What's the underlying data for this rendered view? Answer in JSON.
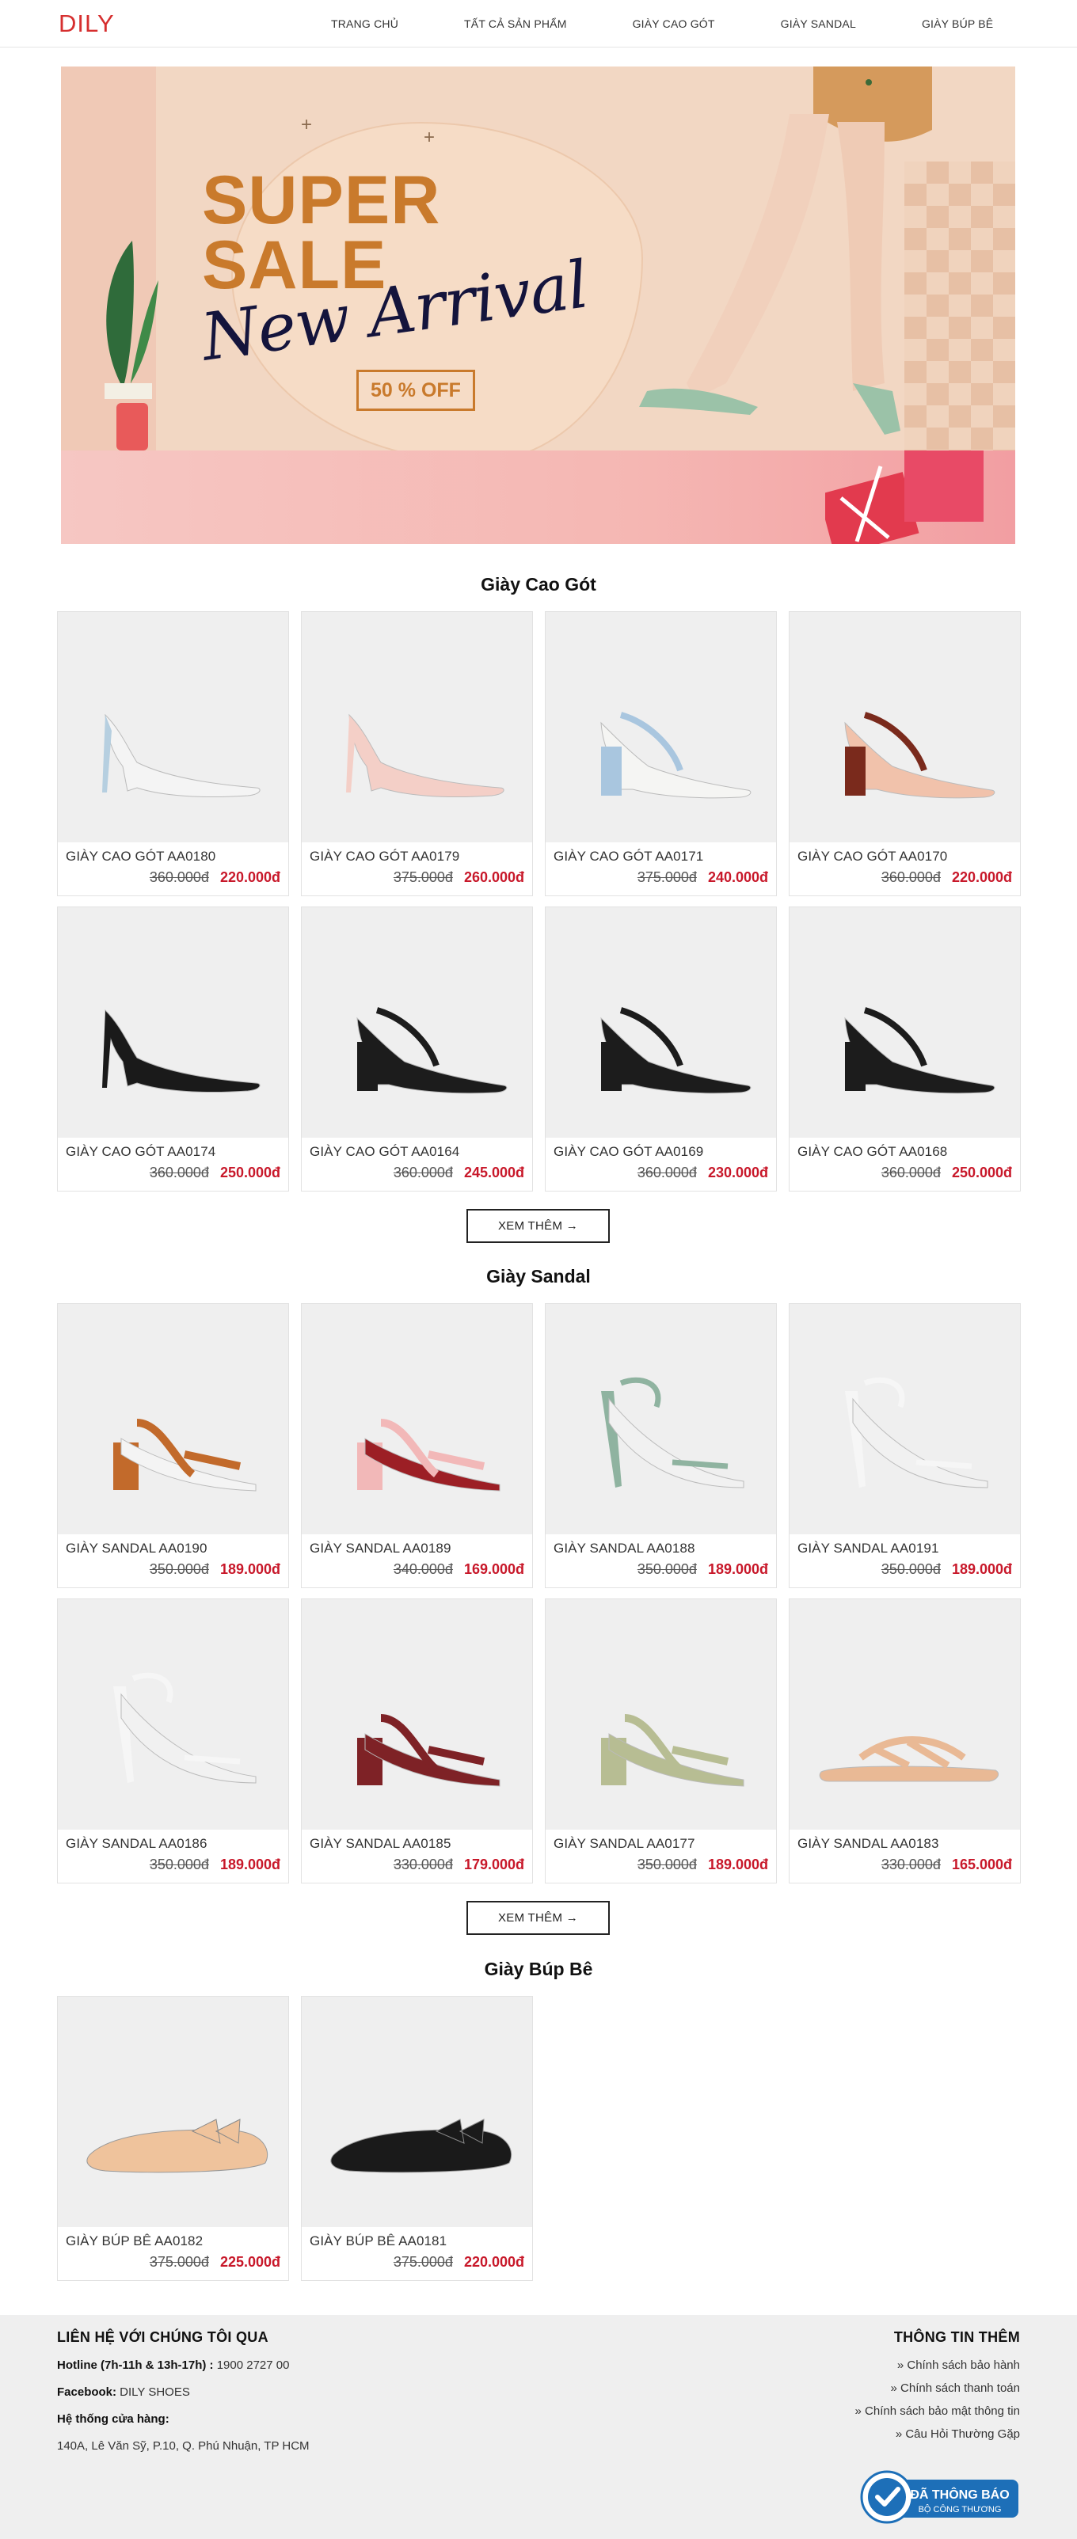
{
  "header": {
    "logo": "DILY",
    "nav": [
      "TRANG CHỦ",
      "TẤT CẢ SẢN PHẨM",
      "GIÀY CAO GÓT",
      "GIÀY SANDAL",
      "GIÀY BÚP BÊ"
    ]
  },
  "banner": {
    "line1": "SUPER",
    "line2": "SALE",
    "script": "New Arrival",
    "discount": "50 % OFF"
  },
  "sections": [
    {
      "title": "Giày Cao Gót",
      "more": "XEM THÊM →",
      "products": [
        {
          "name": "GIÀY CAO GÓT AA0180",
          "old": "360.000đ",
          "new": "220.000đ",
          "color": "#f4f4f4",
          "accent": "#b6cfe0",
          "style": "heel"
        },
        {
          "name": "GIÀY CAO GÓT AA0179",
          "old": "375.000đ",
          "new": "260.000đ",
          "color": "#f4cfc7",
          "accent": "#f4cfc7",
          "style": "pump"
        },
        {
          "name": "GIÀY CAO GÓT AA0171",
          "old": "375.000đ",
          "new": "240.000đ",
          "color": "#f5f5f3",
          "accent": "#a9c6df",
          "style": "block"
        },
        {
          "name": "GIÀY CAO GÓT AA0170",
          "old": "360.000đ",
          "new": "220.000đ",
          "color": "#f1c2ab",
          "accent": "#7a2a1c",
          "style": "block"
        },
        {
          "name": "GIÀY CAO GÓT AA0174",
          "old": "360.000đ",
          "new": "250.000đ",
          "color": "#1a1a1a",
          "accent": "#1a1a1a",
          "style": "pump"
        },
        {
          "name": "GIÀY CAO GÓT AA0164",
          "old": "360.000đ",
          "new": "245.000đ",
          "color": "#1c1c1c",
          "accent": "#1c1c1c",
          "style": "block"
        },
        {
          "name": "GIÀY CAO GÓT AA0169",
          "old": "360.000đ",
          "new": "230.000đ",
          "color": "#1c1c1c",
          "accent": "#1c1c1c",
          "style": "block"
        },
        {
          "name": "GIÀY CAO GÓT AA0168",
          "old": "360.000đ",
          "new": "250.000đ",
          "color": "#1c1c1c",
          "accent": "#1c1c1c",
          "style": "block"
        }
      ]
    },
    {
      "title": "Giày Sandal",
      "more": "XEM THÊM →",
      "products": [
        {
          "name": "GIÀY SANDAL AA0190",
          "old": "350.000đ",
          "new": "189.000đ",
          "color": "#c26a2b",
          "accent": "#f4f4f4",
          "style": "sandal"
        },
        {
          "name": "GIÀY SANDAL AA0189",
          "old": "340.000đ",
          "new": "169.000đ",
          "color": "#f2b8b8",
          "accent": "#9c1f25",
          "style": "sandal"
        },
        {
          "name": "GIÀY SANDAL AA0188",
          "old": "350.000đ",
          "new": "189.000đ",
          "color": "#8fb3a0",
          "accent": "#8fb3a0",
          "style": "stiletto"
        },
        {
          "name": "GIÀY SANDAL AA0191",
          "old": "350.000đ",
          "new": "189.000đ",
          "color": "#f6f6f6",
          "accent": "#f6f6f6",
          "style": "stiletto"
        },
        {
          "name": "GIÀY SANDAL AA0186",
          "old": "350.000đ",
          "new": "189.000đ",
          "color": "#f6f6f6",
          "accent": "#f6f6f6",
          "style": "stiletto"
        },
        {
          "name": "GIÀY SANDAL AA0185",
          "old": "330.000đ",
          "new": "179.000đ",
          "color": "#7e2226",
          "accent": "#7e2226",
          "style": "sandal"
        },
        {
          "name": "GIÀY SANDAL AA0177",
          "old": "350.000đ",
          "new": "189.000đ",
          "color": "#b7bd93",
          "accent": "#b7bd93",
          "style": "sandal"
        },
        {
          "name": "GIÀY SANDAL AA0183",
          "old": "330.000đ",
          "new": "165.000đ",
          "color": "#e9b995",
          "accent": "#e9b995",
          "style": "flat"
        }
      ]
    },
    {
      "title": "Giày Búp Bê",
      "products": [
        {
          "name": "GIÀY BÚP BÊ AA0182",
          "old": "375.000đ",
          "new": "225.000đ",
          "color": "#efc39c",
          "accent": "#efc39c",
          "style": "ballet"
        },
        {
          "name": "GIÀY BÚP BÊ AA0181",
          "old": "375.000đ",
          "new": "220.000đ",
          "color": "#1a1a1a",
          "accent": "#1a1a1a",
          "style": "ballet"
        }
      ]
    }
  ],
  "footer": {
    "contact_title": "LIÊN HỆ VỚI CHÚNG TÔI QUA",
    "hotline_label": "Hotline (7h-11h & 13h-17h) :",
    "hotline_value": " 1900 2727 00",
    "facebook_label": "Facebook:",
    "facebook_value": " DILY SHOES",
    "stores_label": "Hệ thống cửa hàng:",
    "address": "140A, Lê Văn Sỹ, P.10, Q. Phú Nhuận, TP HCM",
    "info_title": "THÔNG TIN THÊM",
    "links": [
      "» Chính sách bảo hành",
      "» Chính sách thanh toán",
      "» Chính sách bảo mật thông tin",
      "» Câu Hỏi Thường Gặp"
    ],
    "badge_line1": "ĐÃ THÔNG BÁO",
    "badge_line2": "BỘ CÔNG THƯƠNG"
  }
}
